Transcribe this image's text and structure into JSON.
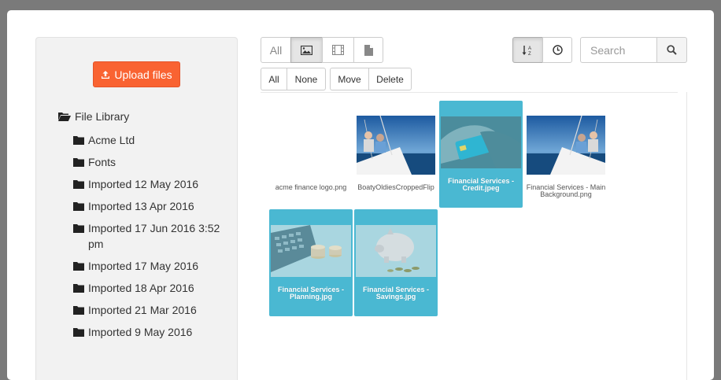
{
  "sidebar": {
    "upload_label": "Upload files",
    "root_label": "File Library",
    "folders": [
      "Acme Ltd",
      "Fonts",
      "Imported 12 May 2016",
      "Imported 13 Apr 2016",
      "Imported 17 Jun 2016 3:52 pm",
      "Imported 17 May 2016",
      "Imported 18 Apr 2016",
      "Imported 21 Mar 2016",
      "Imported 9 May 2016"
    ]
  },
  "toolbar": {
    "filter_all_label": "All",
    "filter_icons": [
      "image-icon",
      "film-icon",
      "document-icon"
    ],
    "select_all_label": "All",
    "select_none_label": "None",
    "move_label": "Move",
    "delete_label": "Delete",
    "sort_icon": "sort-alpha-icon",
    "time_icon": "clock-icon"
  },
  "search": {
    "placeholder": "Search"
  },
  "files": [
    {
      "name": "acme finance logo.png",
      "selected": false
    },
    {
      "name": "BoatyOldiesCroppedFlip",
      "selected": false
    },
    {
      "name": "Financial Services - Credit.jpeg",
      "selected": true
    },
    {
      "name": "Financial Services - Main Background.png",
      "selected": false
    },
    {
      "name": "Financial Services - Planning.jpg",
      "selected": true
    },
    {
      "name": "Financial Services - Savings.jpg",
      "selected": true
    }
  ],
  "colors": {
    "accent": "#f96332",
    "selected": "#4ab8d2"
  }
}
